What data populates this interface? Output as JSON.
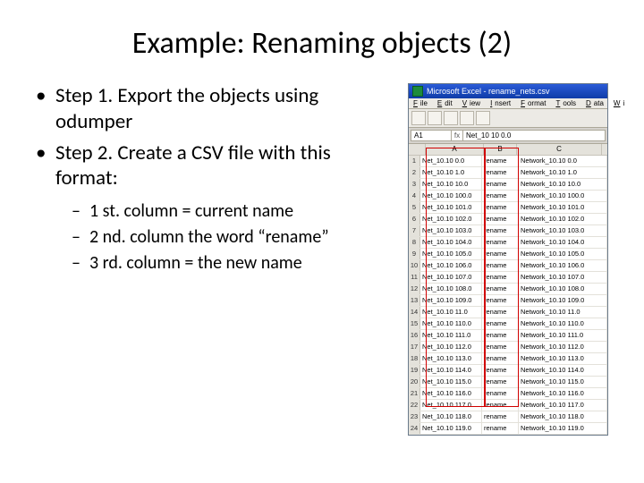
{
  "title": "Example: Renaming objects (2)",
  "steps": [
    "Step 1. Export the objects using odumper",
    "Step 2. Create a CSV file with this format:"
  ],
  "substeps": [
    "1 st. column = current name",
    "2 nd. column the word “rename”",
    "3 rd. column = the new name"
  ],
  "excel": {
    "window_title": "Microsoft Excel - rename_nets.csv",
    "menu": [
      {
        "u": "F",
        "r": "ile"
      },
      {
        "u": "E",
        "r": "dit"
      },
      {
        "u": "V",
        "r": "iew"
      },
      {
        "u": "I",
        "r": "nsert"
      },
      {
        "u": "F",
        "r": "ormat"
      },
      {
        "u": "T",
        "r": "ools"
      },
      {
        "u": "D",
        "r": "ata"
      },
      {
        "u": "W",
        "r": "i"
      }
    ],
    "name_box": "A1",
    "fx": "fx",
    "formula_value": "Net_10 10 0.0",
    "cols": [
      "A",
      "B",
      "C"
    ],
    "rows": [
      {
        "n": 1,
        "a": "Net_10.10 0.0",
        "b": "rename",
        "c": "Network_10.10 0.0"
      },
      {
        "n": 2,
        "a": "Net_10.10 1.0",
        "b": "rename",
        "c": "Network_10.10 1.0"
      },
      {
        "n": 3,
        "a": "Net_10.10 10.0",
        "b": "rename",
        "c": "Network_10.10 10.0"
      },
      {
        "n": 4,
        "a": "Net_10.10 100.0",
        "b": "rename",
        "c": "Network_10.10 100.0"
      },
      {
        "n": 5,
        "a": "Net_10.10 101.0",
        "b": "rename",
        "c": "Network_10.10 101.0"
      },
      {
        "n": 6,
        "a": "Net_10.10 102.0",
        "b": "rename",
        "c": "Network_10.10 102.0"
      },
      {
        "n": 7,
        "a": "Net_10.10 103.0",
        "b": "rename",
        "c": "Network_10.10 103.0"
      },
      {
        "n": 8,
        "a": "Net_10.10 104.0",
        "b": "rename",
        "c": "Network_10.10 104.0"
      },
      {
        "n": 9,
        "a": "Net_10.10 105.0",
        "b": "rename",
        "c": "Network_10.10 105.0"
      },
      {
        "n": 10,
        "a": "Net_10.10 106.0",
        "b": "rename",
        "c": "Network_10.10 106.0"
      },
      {
        "n": 11,
        "a": "Net_10.10 107.0",
        "b": "rename",
        "c": "Network_10.10 107.0"
      },
      {
        "n": 12,
        "a": "Net_10.10 108.0",
        "b": "rename",
        "c": "Network_10.10 108.0"
      },
      {
        "n": 13,
        "a": "Net_10.10 109.0",
        "b": "rename",
        "c": "Network_10.10 109.0"
      },
      {
        "n": 14,
        "a": "Net_10.10 11.0",
        "b": "rename",
        "c": "Network_10.10 11.0"
      },
      {
        "n": 15,
        "a": "Net_10.10 110.0",
        "b": "rename",
        "c": "Network_10.10 110.0"
      },
      {
        "n": 16,
        "a": "Net_10.10 111.0",
        "b": "rename",
        "c": "Network_10.10 111.0"
      },
      {
        "n": 17,
        "a": "Net_10.10 112.0",
        "b": "rename",
        "c": "Network_10.10 112.0"
      },
      {
        "n": 18,
        "a": "Net_10.10 113.0",
        "b": "rename",
        "c": "Network_10.10 113.0"
      },
      {
        "n": 19,
        "a": "Net_10.10 114.0",
        "b": "rename",
        "c": "Network_10.10 114.0"
      },
      {
        "n": 20,
        "a": "Net_10.10 115.0",
        "b": "rename",
        "c": "Network_10.10 115.0"
      },
      {
        "n": 21,
        "a": "Net_10.10 116.0",
        "b": "rename",
        "c": "Network_10.10 116.0"
      },
      {
        "n": 22,
        "a": "Net_10.10 117.0",
        "b": "rename",
        "c": "Network_10.10 117.0"
      },
      {
        "n": 23,
        "a": "Net_10.10 118.0",
        "b": "rename",
        "c": "Network_10.10 118.0"
      },
      {
        "n": 24,
        "a": "Net_10.10 119.0",
        "b": "rename",
        "c": "Network_10.10 119.0"
      }
    ]
  }
}
